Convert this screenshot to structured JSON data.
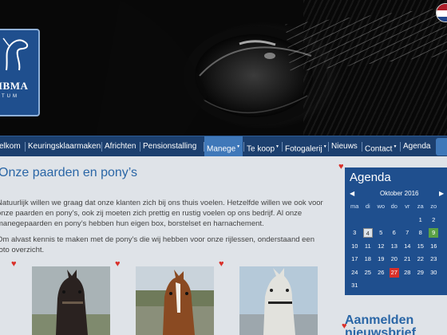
{
  "brand": {
    "logo_text": "IBMA",
    "logo_sub": "TUM"
  },
  "nav": {
    "items": [
      {
        "label": "elkom",
        "caret": ""
      },
      {
        "label": "Keuringsklaarmaken",
        "caret": ""
      },
      {
        "label": "Africhten",
        "caret": ""
      },
      {
        "label": "Pensionstalling",
        "caret": ""
      },
      {
        "label": "Manege",
        "caret": "▼",
        "active": true
      },
      {
        "label": "Te koop",
        "caret": "▼"
      },
      {
        "label": "Fotogalerij",
        "caret": "▼"
      },
      {
        "label": "Nieuws",
        "caret": ""
      },
      {
        "label": "Contact",
        "caret": "▼"
      },
      {
        "label": "Agenda",
        "caret": ""
      }
    ]
  },
  "main": {
    "title": "Onze paarden en pony’s",
    "paragraphs": [
      "Natuurlijk willen we graag dat onze klanten zich bij ons thuis voelen. Hetzelfde willen we ook voor onze paarden en pony’s, ook zij moeten zich prettig en rustig voelen op ons bedrijf. Al onze manegepaarden en pony’s hebben hun eigen box, borstelset en harnachement.",
      "Om alvast kennis te maken met de pony’s die wij hebben voor onze rijlessen, onderstaand een foto overzicht."
    ]
  },
  "agenda": {
    "title": "Agenda",
    "prev": "◀",
    "next": "▶",
    "month": "Oktober 2016",
    "weekdays": [
      "ma",
      "di",
      "wo",
      "do",
      "vr",
      "za",
      "zo"
    ],
    "weeks": [
      [
        "",
        "",
        "",
        "",
        "",
        "1",
        "2"
      ],
      [
        "3",
        "4",
        "5",
        "6",
        "7",
        "8",
        "9"
      ],
      [
        "10",
        "11",
        "12",
        "13",
        "14",
        "15",
        "16"
      ],
      [
        "17",
        "18",
        "19",
        "20",
        "21",
        "22",
        "23"
      ],
      [
        "24",
        "25",
        "26",
        "27",
        "28",
        "29",
        "30"
      ],
      [
        "31",
        "",
        "",
        "",
        "",
        "",
        ""
      ]
    ],
    "today": "4",
    "green_days": [
      "9"
    ],
    "red_days": [
      "27"
    ],
    "colors": {
      "panel": "#1f4f8e",
      "today": "#dde3ea",
      "green": "#5aa146",
      "red": "#d9302a"
    }
  },
  "newsletter": {
    "title": "Aanmelden nieuwsbrief"
  },
  "icons": {
    "heart": "♥",
    "flag": "netherlands-flag-icon"
  },
  "colors": {
    "nav": "#1c3f6e",
    "nav_active": "#3f78b9",
    "title": "#2a66a6",
    "heart": "#d9302a"
  }
}
